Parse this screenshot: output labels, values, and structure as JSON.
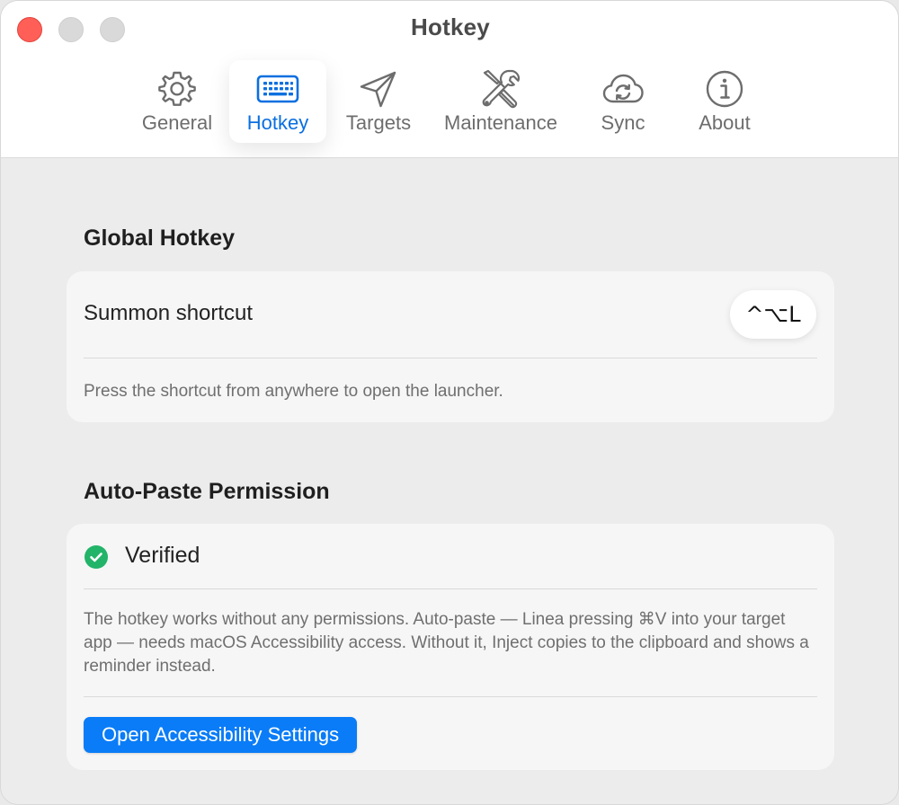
{
  "window": {
    "title": "Hotkey"
  },
  "tabs": [
    {
      "label": "General",
      "icon": "gear-icon",
      "active": false
    },
    {
      "label": "Hotkey",
      "icon": "keyboard-icon",
      "active": true
    },
    {
      "label": "Targets",
      "icon": "paper-plane-icon",
      "active": false
    },
    {
      "label": "Maintenance",
      "icon": "tools-icon",
      "active": false
    },
    {
      "label": "Sync",
      "icon": "cloud-sync-icon",
      "active": false
    },
    {
      "label": "About",
      "icon": "info-icon",
      "active": false
    }
  ],
  "global_hotkey": {
    "title": "Global Hotkey",
    "row_label": "Summon shortcut",
    "shortcut": "^⌥L",
    "description": "Press the shortcut from anywhere to open the launcher."
  },
  "auto_paste": {
    "title": "Auto-Paste Permission",
    "status": "Verified",
    "status_icon": "check-circle-icon",
    "description": "The hotkey works without any permissions. Auto-paste — Linea pressing ⌘V into your target app — needs macOS Accessibility access. Without it, Inject copies to the clipboard and shows a reminder instead.",
    "button_label": "Open Accessibility Settings"
  },
  "colors": {
    "accent": "#0a7cf7",
    "active_tab_text": "#0a6fe0",
    "verified": "#22b469",
    "close_button": "#ff5f57"
  }
}
